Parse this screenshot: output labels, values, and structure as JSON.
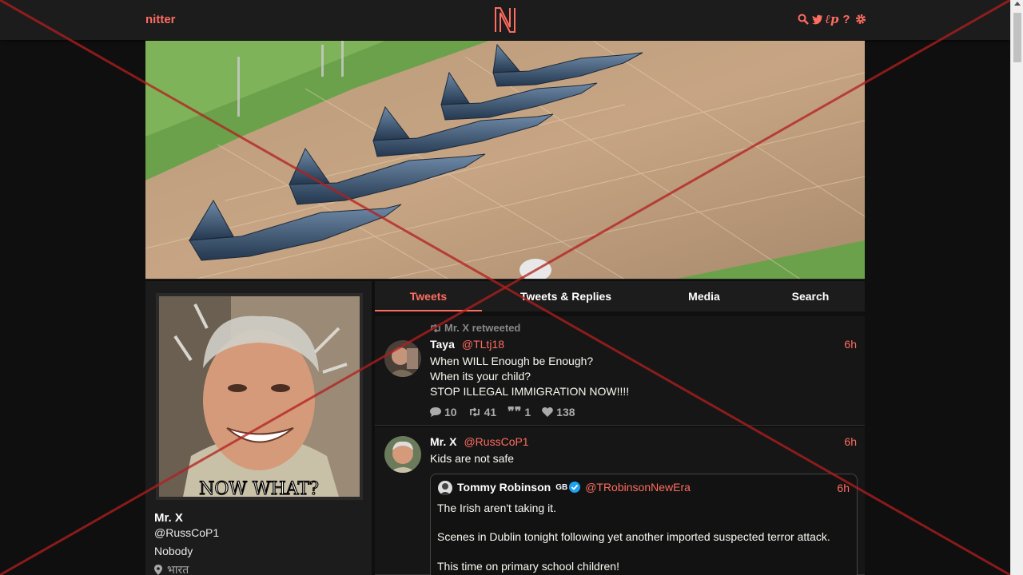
{
  "nav": {
    "brand": "nitter",
    "icons": [
      "search-icon",
      "twitter-bird-icon",
      "liberapay-icon",
      "help-icon",
      "gear-icon"
    ],
    "accent": "#ff6c60"
  },
  "profile": {
    "fullname": "Mr. X",
    "username": "@RussCoP1",
    "bio": "Nobody",
    "location": "भारत",
    "avatar_caption": "NOW WHAT?"
  },
  "tabs": [
    {
      "label": "Tweets",
      "active": true
    },
    {
      "label": "Tweets & Replies",
      "active": false
    },
    {
      "label": "Media",
      "active": false
    },
    {
      "label": "Search",
      "active": false
    }
  ],
  "tweets": [
    {
      "retweet_header": "Mr. X retweeted",
      "fullname": "Taya",
      "username": "@TLtj18",
      "date": "6h",
      "lines": [
        "When WILL Enough be Enough?",
        "When its your child?",
        "STOP ILLEGAL IMMIGRATION NOW!!!!"
      ],
      "stats": {
        "replies": "10",
        "retweets": "41",
        "quotes": "1",
        "likes": "138"
      }
    },
    {
      "fullname": "Mr. X",
      "username": "@RussCoP1",
      "date": "6h",
      "text": "Kids are not safe",
      "quote": {
        "fullname": "Tommy Robinson",
        "flag": "GB",
        "username": "@TRobinsonNewEra",
        "date": "6h",
        "paragraphs": [
          "The Irish aren't taking it.",
          "Scenes in Dublin tonight following yet another imported suspected terror attack.",
          "This time on primary school children!"
        ]
      }
    }
  ],
  "colors": {
    "background": "#0f0f0f",
    "panel": "#1c1c1c",
    "accent": "#ff6c60",
    "cross": "#b41e1e"
  }
}
